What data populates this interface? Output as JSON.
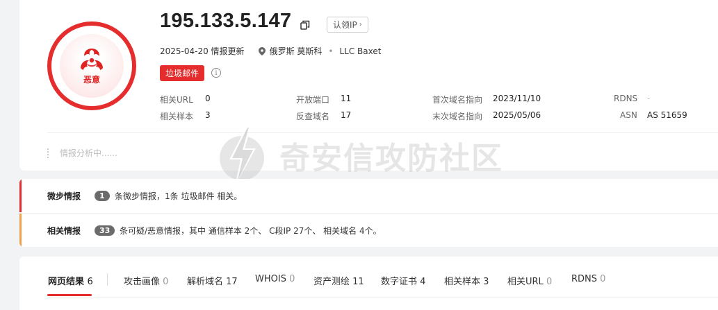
{
  "ip": {
    "address": "195.133.5.147",
    "claim_label": "认领IP",
    "update_date": "2025-04-20 情报更新",
    "location": "俄罗斯 莫斯科",
    "org": "LLC Baxet",
    "threat_label": "恶意",
    "tag": "垃圾邮件",
    "info_icon": "ⓘ"
  },
  "stats": {
    "related_url_label": "相关URL",
    "related_url_value": "0",
    "related_sample_label": "相关样本",
    "related_sample_value": "3",
    "open_ports_label": "开放端口",
    "open_ports_value": "11",
    "reverse_domain_label": "反查域名",
    "reverse_domain_value": "17",
    "first_domain_label": "首次域名指向",
    "first_domain_value": "2023/11/10",
    "last_domain_label": "末次域名指向",
    "last_domain_value": "2025/05/06",
    "rdns_label": "RDNS",
    "rdns_value": "-",
    "asn_label": "ASN",
    "asn_value": "AS 51659"
  },
  "analysis": {
    "status": "情报分析中......"
  },
  "watermark": {
    "text": "奇安信攻防社区"
  },
  "intel": {
    "micro": {
      "title": "微步情报",
      "count": "1",
      "desc": "条微步情报，1条 垃圾邮件 相关。",
      "bar_color": "#e52d2d"
    },
    "related": {
      "title": "相关情报",
      "count": "33",
      "desc": "条可疑/恶意情报，其中 通信样本 2个、 C段IP 27个、 相关域名 4个。",
      "bar_color": "#f0a04b"
    }
  },
  "tabs": [
    {
      "label": "网页结果",
      "count": "6"
    },
    {
      "label": "攻击画像",
      "count": "0"
    },
    {
      "label": "解析域名",
      "count": "17"
    },
    {
      "label": "WHOIS",
      "count": "0"
    },
    {
      "label": "资产测绘",
      "count": "11"
    },
    {
      "label": "数字证书",
      "count": "4"
    },
    {
      "label": "相关样本",
      "count": "3"
    },
    {
      "label": "相关URL",
      "count": "0"
    },
    {
      "label": "RDNS",
      "count": "0"
    }
  ],
  "colors": {
    "accent": "#e52d2d",
    "warning": "#f0a04b"
  }
}
